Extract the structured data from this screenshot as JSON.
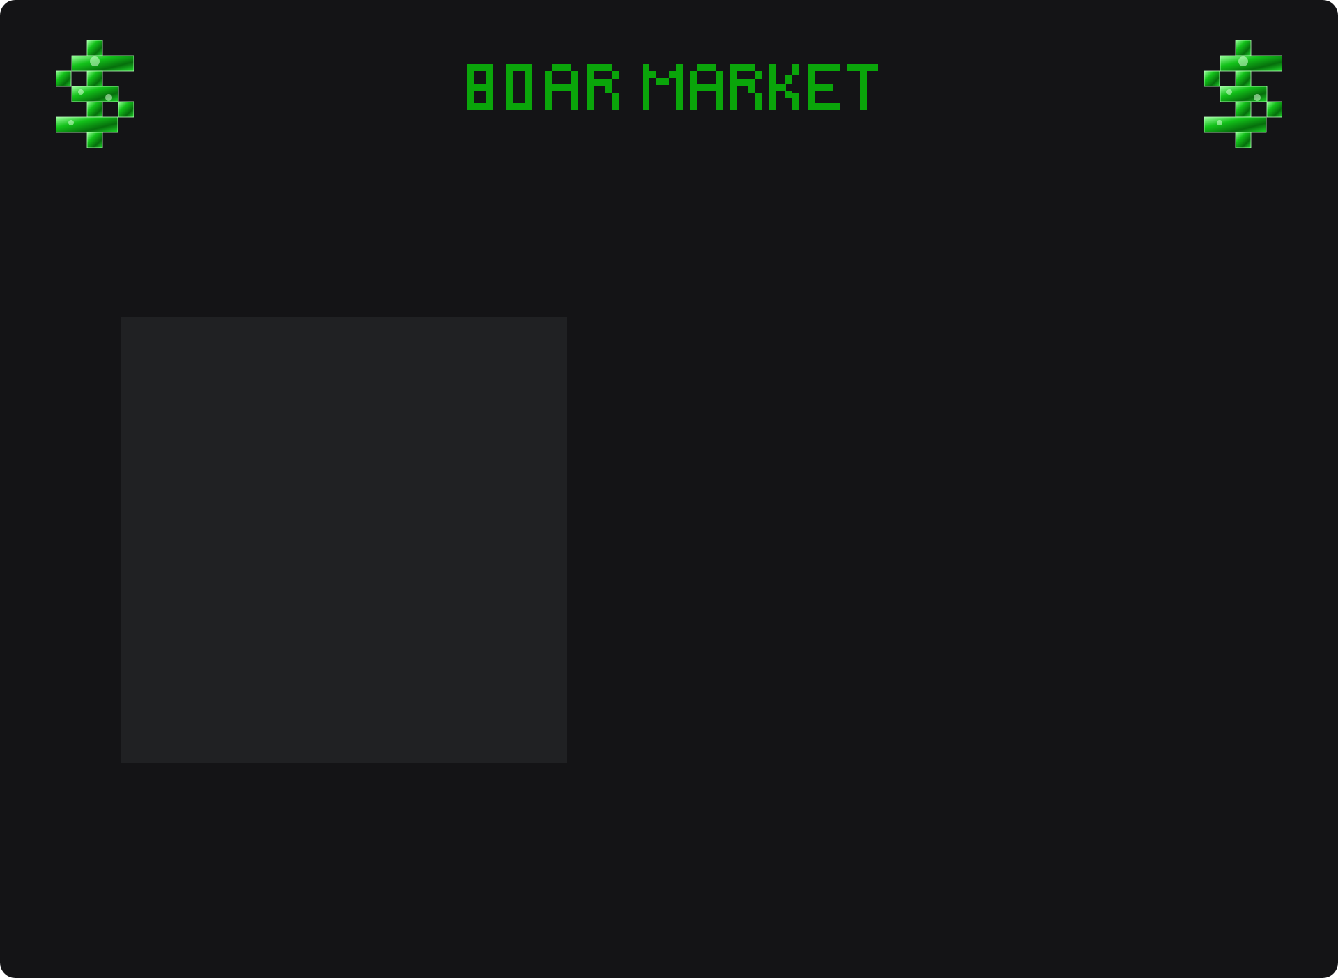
{
  "header": {
    "title": "BOAR MARKET",
    "title_color": "#0aa50a",
    "left_icon": "dollar-sign-pixel-icon",
    "right_icon": "dollar-sign-pixel-icon"
  },
  "theme": {
    "background": "#141416",
    "panel": "#202123",
    "accent": "#0aa50a"
  },
  "main": {
    "panel_label": ""
  }
}
